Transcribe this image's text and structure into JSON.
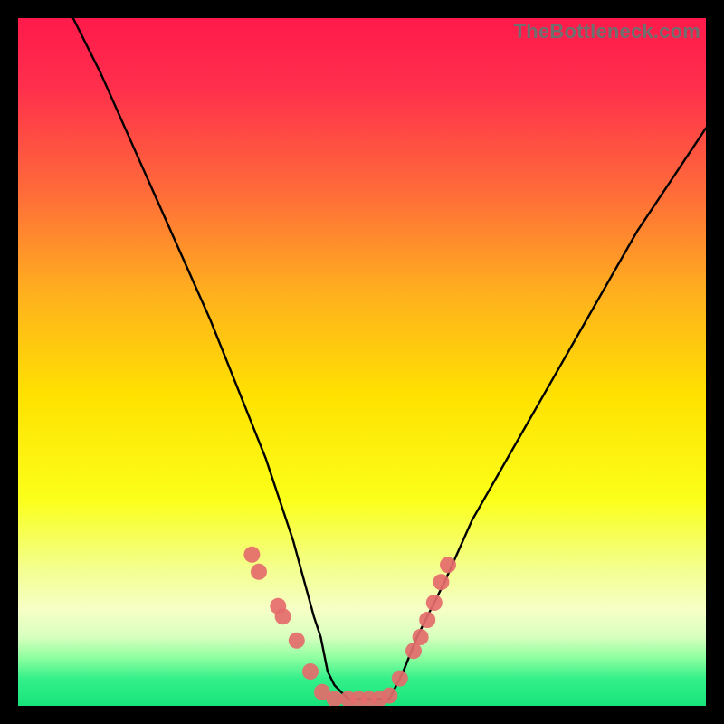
{
  "watermark": "TheBottleneck.com",
  "chart_data": {
    "type": "line",
    "title": "",
    "xlabel": "",
    "ylabel": "",
    "xlim": [
      0,
      100
    ],
    "ylim": [
      0,
      100
    ],
    "gradient_stops": [
      {
        "offset": 0.0,
        "color": "#ff1a4b"
      },
      {
        "offset": 0.1,
        "color": "#ff2f4c"
      },
      {
        "offset": 0.25,
        "color": "#ff6a3a"
      },
      {
        "offset": 0.4,
        "color": "#ffb01e"
      },
      {
        "offset": 0.55,
        "color": "#ffe200"
      },
      {
        "offset": 0.7,
        "color": "#fbff1a"
      },
      {
        "offset": 0.8,
        "color": "#f3ff8e"
      },
      {
        "offset": 0.86,
        "color": "#f6ffc6"
      },
      {
        "offset": 0.9,
        "color": "#d7ffbe"
      },
      {
        "offset": 0.93,
        "color": "#8effa0"
      },
      {
        "offset": 0.96,
        "color": "#35f08a"
      },
      {
        "offset": 1.0,
        "color": "#17e47a"
      }
    ],
    "green_band": {
      "from_pct": 90,
      "to_pct": 100
    },
    "series": [
      {
        "name": "bottleneck-curve",
        "x": [
          8,
          12,
          16,
          20,
          24,
          28,
          32,
          36,
          40,
          43,
          44,
          45,
          46,
          48,
          50,
          52,
          54,
          55,
          56,
          58,
          62,
          66,
          70,
          74,
          78,
          82,
          86,
          90,
          94,
          98,
          100
        ],
        "y": [
          100,
          92,
          83,
          74,
          65,
          56,
          46,
          36,
          24,
          13,
          10,
          5,
          3,
          1,
          1,
          1,
          1,
          3,
          5,
          10,
          18,
          27,
          34,
          41,
          48,
          55,
          62,
          69,
          75,
          81,
          84
        ]
      }
    ],
    "markers": {
      "name": "highlight-points",
      "color": "#e46b6b",
      "radius": 9,
      "points": [
        {
          "x": 34.0,
          "y": 22.0
        },
        {
          "x": 35.0,
          "y": 19.5
        },
        {
          "x": 37.8,
          "y": 14.5
        },
        {
          "x": 38.5,
          "y": 13.0
        },
        {
          "x": 40.5,
          "y": 9.5
        },
        {
          "x": 42.5,
          "y": 5.0
        },
        {
          "x": 44.2,
          "y": 2.0
        },
        {
          "x": 46.0,
          "y": 1.0
        },
        {
          "x": 48.0,
          "y": 1.0
        },
        {
          "x": 49.5,
          "y": 1.0
        },
        {
          "x": 51.0,
          "y": 1.0
        },
        {
          "x": 52.5,
          "y": 1.0
        },
        {
          "x": 54.0,
          "y": 1.5
        },
        {
          "x": 55.5,
          "y": 4.0
        },
        {
          "x": 57.5,
          "y": 8.0
        },
        {
          "x": 58.5,
          "y": 10.0
        },
        {
          "x": 59.5,
          "y": 12.5
        },
        {
          "x": 60.5,
          "y": 15.0
        },
        {
          "x": 61.5,
          "y": 18.0
        },
        {
          "x": 62.5,
          "y": 20.5
        }
      ]
    }
  }
}
